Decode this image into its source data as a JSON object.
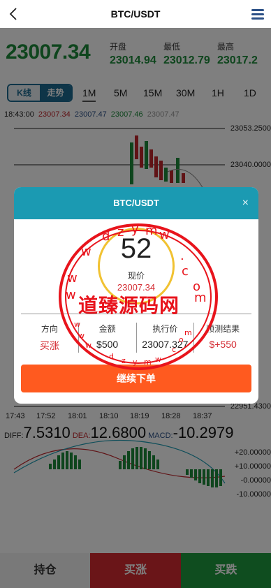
{
  "header": {
    "title": "BTC/USDT"
  },
  "price": {
    "last": "23007.34",
    "open_label": "开盘",
    "open": "23014.94",
    "low_label": "最低",
    "low": "23012.79",
    "high_label": "最高",
    "high": "23017.2"
  },
  "chart_mode": {
    "kline": "K线",
    "trend": "走势"
  },
  "timeframes": [
    "1M",
    "5M",
    "15M",
    "30M",
    "1H",
    "1D"
  ],
  "ohlc": {
    "time": "18:43:00",
    "o": "23007.34",
    "h": "23007.47",
    "l": "23007.46",
    "c": "23007.47"
  },
  "price_axis": [
    "23053.2500",
    "23040.0000",
    "22951.4300"
  ],
  "time_axis": [
    "17:43",
    "17:52",
    "18:01",
    "18:10",
    "18:19",
    "18:28",
    "18:37"
  ],
  "macd": {
    "diff_label": "DIFF:",
    "diff": "7.5310",
    "dea_label": "DEA:",
    "dea": "12.6800",
    "macd_label": "MACD:",
    "macd": "-10.2979",
    "axis": [
      "+20.00000",
      "+10.00000",
      "-0.00000",
      "-10.00000"
    ]
  },
  "modal": {
    "title": "BTC/USDT",
    "close": "×",
    "countdown": "52",
    "now_label": "现价",
    "now_value": "23007.34",
    "cols": [
      {
        "h": "方向",
        "v": "买涨"
      },
      {
        "h": "金额",
        "v": "$500"
      },
      {
        "h": "执行价",
        "v": "23007.327"
      },
      {
        "h": "预测结果",
        "v": "$+550"
      }
    ],
    "continue": "继续下单"
  },
  "watermark": {
    "text": "道臻源码网"
  },
  "bottom": {
    "position": "持仓",
    "buy_up": "买涨",
    "buy_down": "买跌"
  },
  "colors": {
    "up": "#1d8a3a",
    "down": "#d42a31",
    "accent": "#1b9ab2",
    "cta": "#ff5a1f"
  }
}
